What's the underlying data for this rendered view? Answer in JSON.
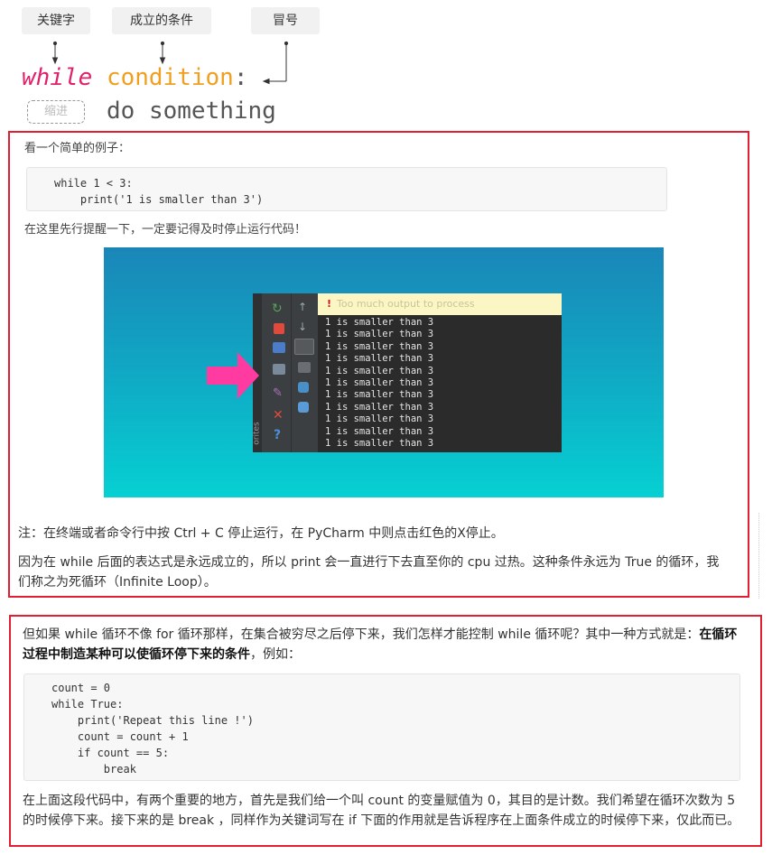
{
  "diagram": {
    "tags": {
      "keyword": "关键字",
      "condition": "成立的条件",
      "colon": "冒号"
    },
    "code": {
      "while": "while",
      "condition": "condition",
      "colon": ":",
      "body": "do something"
    },
    "indent_label": "缩进"
  },
  "box1": {
    "intro": "看一个简单的例子：",
    "code": "while 1 < 3:\n    print('1 is smaller than 3')",
    "reminder": "在这里先行提醒一下，一定要记得及时停止运行代码！",
    "ide": {
      "warning": "Too much output to process",
      "output_line": "1 is smaller than 3",
      "output_count": 11,
      "side_label": "orites"
    },
    "note": "注：在终端或者命令行中按 Ctrl + C 停止运行，在 PyCharm 中则点击红色的X停止。",
    "explain": "因为在 while 后面的表达式是永远成立的，所以 print 会一直进行下去直至你的 cpu 过热。这种条件永远为 True 的循环，我们称之为死循环（Infinite Loop）。"
  },
  "box2": {
    "intro_a": "但如果 while 循环不像 for 循环那样，在集合被穷尽之后停下来，我们怎样才能控制 while 循环呢？其中一种方式就是：",
    "intro_bold": "在循环过程中制造某种可以使循环停下来的条件",
    "intro_b": "，例如：",
    "code": "count = 0\nwhile True:\n    print('Repeat this line !')\n    count = count + 1\n    if count == 5:\n        break",
    "explain": "在上面这段代码中，有两个重要的地方，首先是我们给一个叫 count 的变量赋值为 0，其目的是计数。我们希望在循环次数为 5 的时候停下来。接下来的是 break ，同样作为关键词写在 if 下面的作用就是告诉程序在上面条件成立的时候停下来，仅此而已。"
  }
}
